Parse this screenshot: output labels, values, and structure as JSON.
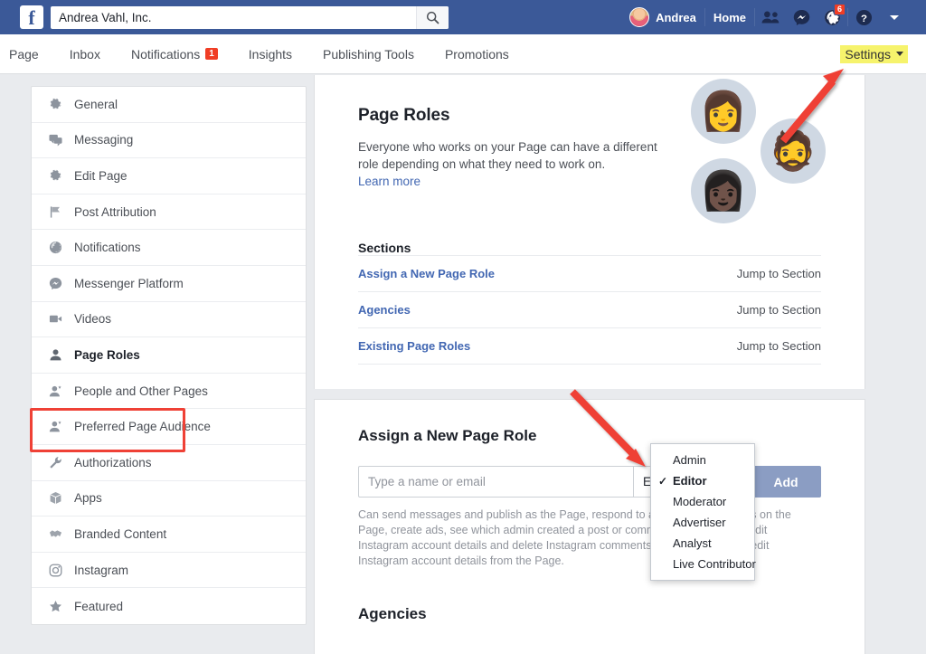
{
  "topbar": {
    "logo_letter": "f",
    "search_value": "Andrea Vahl, Inc.",
    "search_placeholder": "Search",
    "user_name": "Andrea",
    "home_label": "Home",
    "globe_badge": "6"
  },
  "nav": {
    "items": [
      {
        "label": "Page",
        "badge": ""
      },
      {
        "label": "Inbox",
        "badge": ""
      },
      {
        "label": "Notifications",
        "badge": "1"
      },
      {
        "label": "Insights",
        "badge": ""
      },
      {
        "label": "Publishing Tools",
        "badge": ""
      },
      {
        "label": "Promotions",
        "badge": ""
      }
    ],
    "settings_label": "Settings"
  },
  "sidebar": {
    "items": [
      {
        "label": "General",
        "icon": "gear-icon",
        "active": false
      },
      {
        "label": "Messaging",
        "icon": "chat-bubbles-icon",
        "active": false
      },
      {
        "label": "Edit Page",
        "icon": "gear-icon",
        "active": false
      },
      {
        "label": "Post Attribution",
        "icon": "flag-icon",
        "active": false
      },
      {
        "label": "Notifications",
        "icon": "globe-icon",
        "active": false
      },
      {
        "label": "Messenger Platform",
        "icon": "messenger-icon",
        "active": false
      },
      {
        "label": "Videos",
        "icon": "video-camera-icon",
        "active": false
      },
      {
        "label": "Page Roles",
        "icon": "person-icon",
        "active": true
      },
      {
        "label": "People and Other Pages",
        "icon": "person-star-icon",
        "active": false
      },
      {
        "label": "Preferred Page Audience",
        "icon": "person-star-icon",
        "active": false
      },
      {
        "label": "Authorizations",
        "icon": "wrench-icon",
        "active": false
      },
      {
        "label": "Apps",
        "icon": "box-icon",
        "active": false
      },
      {
        "label": "Branded Content",
        "icon": "handshake-icon",
        "active": false
      },
      {
        "label": "Instagram",
        "icon": "instagram-icon",
        "active": false
      },
      {
        "label": "Featured",
        "icon": "star-icon",
        "active": false
      }
    ]
  },
  "hero": {
    "title": "Page Roles",
    "description": "Everyone who works on your Page can have a different role depending on what they need to work on.",
    "learn_more": "Learn more",
    "avatars": [
      "👩",
      "🧔",
      "👩🏿"
    ]
  },
  "sections": {
    "heading": "Sections",
    "jump_label": "Jump to Section",
    "rows": [
      {
        "name": "Assign a New Page Role"
      },
      {
        "name": "Agencies"
      },
      {
        "name": "Existing Page Roles"
      }
    ]
  },
  "assign": {
    "title": "Assign a New Page Role",
    "name_placeholder": "Type a name or email",
    "name_value": "",
    "selected_role": "Editor",
    "add_label": "Add",
    "helper": "Can send messages and publish as the Page, respond to and delete comments on the Page, create ads, see which admin created a post or comment, view Insights, edit Instagram account details and delete Instagram comments from the Page and edit Instagram account details from the Page."
  },
  "role_dropdown": {
    "options": [
      {
        "label": "Admin",
        "checked": false
      },
      {
        "label": "Editor",
        "checked": true
      },
      {
        "label": "Moderator",
        "checked": false
      },
      {
        "label": "Advertiser",
        "checked": false
      },
      {
        "label": "Analyst",
        "checked": false
      },
      {
        "label": "Live Contributor",
        "checked": false
      }
    ],
    "check_glyph": "✓"
  },
  "agencies": {
    "title": "Agencies"
  },
  "colors": {
    "fb_blue": "#3b5998",
    "link_blue": "#4267b2",
    "annotation_red": "#ef4136",
    "highlight_yellow": "#f6f36c",
    "badge_red": "#f03d25",
    "add_button": "#8b9dc3"
  }
}
